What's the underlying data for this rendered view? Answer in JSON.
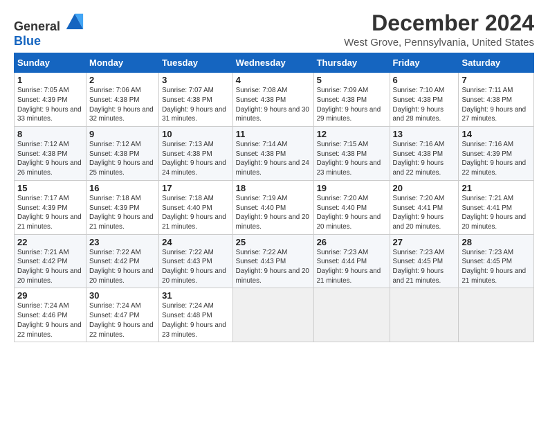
{
  "logo": {
    "general": "General",
    "blue": "Blue"
  },
  "title": "December 2024",
  "subtitle": "West Grove, Pennsylvania, United States",
  "days_of_week": [
    "Sunday",
    "Monday",
    "Tuesday",
    "Wednesday",
    "Thursday",
    "Friday",
    "Saturday"
  ],
  "weeks": [
    [
      {
        "day": "1",
        "sunrise": "7:05 AM",
        "sunset": "4:39 PM",
        "daylight": "9 hours and 33 minutes."
      },
      {
        "day": "2",
        "sunrise": "7:06 AM",
        "sunset": "4:38 PM",
        "daylight": "9 hours and 32 minutes."
      },
      {
        "day": "3",
        "sunrise": "7:07 AM",
        "sunset": "4:38 PM",
        "daylight": "9 hours and 31 minutes."
      },
      {
        "day": "4",
        "sunrise": "7:08 AM",
        "sunset": "4:38 PM",
        "daylight": "9 hours and 30 minutes."
      },
      {
        "day": "5",
        "sunrise": "7:09 AM",
        "sunset": "4:38 PM",
        "daylight": "9 hours and 29 minutes."
      },
      {
        "day": "6",
        "sunrise": "7:10 AM",
        "sunset": "4:38 PM",
        "daylight": "9 hours and 28 minutes."
      },
      {
        "day": "7",
        "sunrise": "7:11 AM",
        "sunset": "4:38 PM",
        "daylight": "9 hours and 27 minutes."
      }
    ],
    [
      {
        "day": "8",
        "sunrise": "7:12 AM",
        "sunset": "4:38 PM",
        "daylight": "9 hours and 26 minutes."
      },
      {
        "day": "9",
        "sunrise": "7:12 AM",
        "sunset": "4:38 PM",
        "daylight": "9 hours and 25 minutes."
      },
      {
        "day": "10",
        "sunrise": "7:13 AM",
        "sunset": "4:38 PM",
        "daylight": "9 hours and 24 minutes."
      },
      {
        "day": "11",
        "sunrise": "7:14 AM",
        "sunset": "4:38 PM",
        "daylight": "9 hours and 24 minutes."
      },
      {
        "day": "12",
        "sunrise": "7:15 AM",
        "sunset": "4:38 PM",
        "daylight": "9 hours and 23 minutes."
      },
      {
        "day": "13",
        "sunrise": "7:16 AM",
        "sunset": "4:38 PM",
        "daylight": "9 hours and 22 minutes."
      },
      {
        "day": "14",
        "sunrise": "7:16 AM",
        "sunset": "4:39 PM",
        "daylight": "9 hours and 22 minutes."
      }
    ],
    [
      {
        "day": "15",
        "sunrise": "7:17 AM",
        "sunset": "4:39 PM",
        "daylight": "9 hours and 21 minutes."
      },
      {
        "day": "16",
        "sunrise": "7:18 AM",
        "sunset": "4:39 PM",
        "daylight": "9 hours and 21 minutes."
      },
      {
        "day": "17",
        "sunrise": "7:18 AM",
        "sunset": "4:40 PM",
        "daylight": "9 hours and 21 minutes."
      },
      {
        "day": "18",
        "sunrise": "7:19 AM",
        "sunset": "4:40 PM",
        "daylight": "9 hours and 20 minutes."
      },
      {
        "day": "19",
        "sunrise": "7:20 AM",
        "sunset": "4:40 PM",
        "daylight": "9 hours and 20 minutes."
      },
      {
        "day": "20",
        "sunrise": "7:20 AM",
        "sunset": "4:41 PM",
        "daylight": "9 hours and 20 minutes."
      },
      {
        "day": "21",
        "sunrise": "7:21 AM",
        "sunset": "4:41 PM",
        "daylight": "9 hours and 20 minutes."
      }
    ],
    [
      {
        "day": "22",
        "sunrise": "7:21 AM",
        "sunset": "4:42 PM",
        "daylight": "9 hours and 20 minutes."
      },
      {
        "day": "23",
        "sunrise": "7:22 AM",
        "sunset": "4:42 PM",
        "daylight": "9 hours and 20 minutes."
      },
      {
        "day": "24",
        "sunrise": "7:22 AM",
        "sunset": "4:43 PM",
        "daylight": "9 hours and 20 minutes."
      },
      {
        "day": "25",
        "sunrise": "7:22 AM",
        "sunset": "4:43 PM",
        "daylight": "9 hours and 20 minutes."
      },
      {
        "day": "26",
        "sunrise": "7:23 AM",
        "sunset": "4:44 PM",
        "daylight": "9 hours and 21 minutes."
      },
      {
        "day": "27",
        "sunrise": "7:23 AM",
        "sunset": "4:45 PM",
        "daylight": "9 hours and 21 minutes."
      },
      {
        "day": "28",
        "sunrise": "7:23 AM",
        "sunset": "4:45 PM",
        "daylight": "9 hours and 21 minutes."
      }
    ],
    [
      {
        "day": "29",
        "sunrise": "7:24 AM",
        "sunset": "4:46 PM",
        "daylight": "9 hours and 22 minutes."
      },
      {
        "day": "30",
        "sunrise": "7:24 AM",
        "sunset": "4:47 PM",
        "daylight": "9 hours and 22 minutes."
      },
      {
        "day": "31",
        "sunrise": "7:24 AM",
        "sunset": "4:48 PM",
        "daylight": "9 hours and 23 minutes."
      },
      null,
      null,
      null,
      null
    ]
  ],
  "labels": {
    "sunrise": "Sunrise:",
    "sunset": "Sunset:",
    "daylight": "Daylight:"
  }
}
